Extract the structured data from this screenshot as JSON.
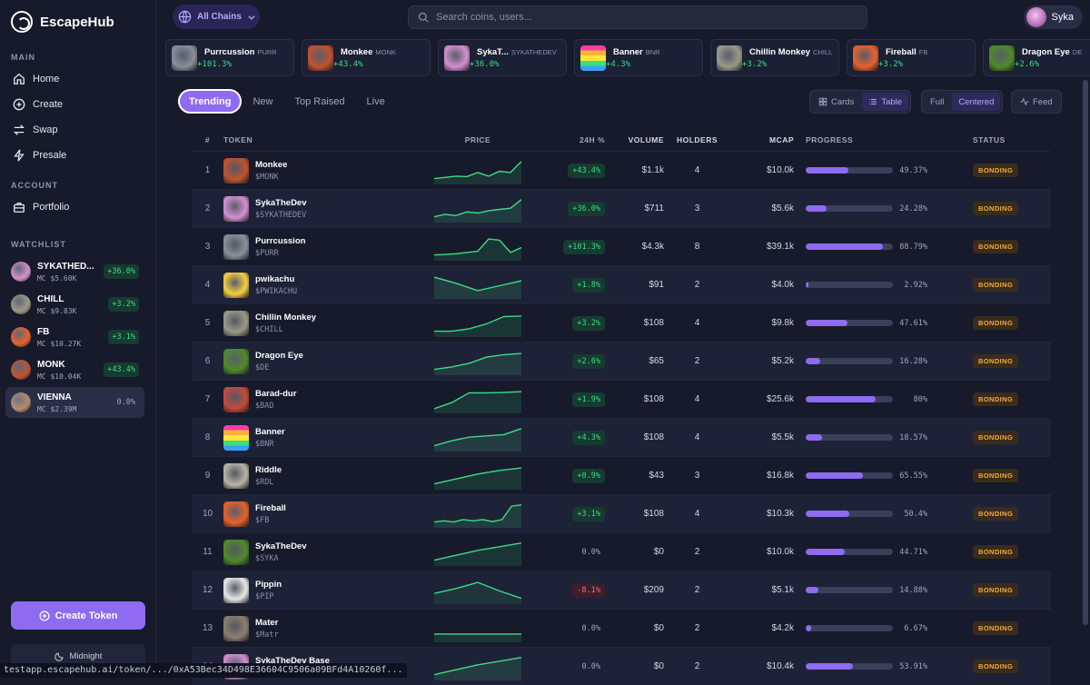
{
  "app": {
    "name": "EscapeHub"
  },
  "sidebar": {
    "main_label": "MAIN",
    "nav": [
      {
        "label": "Home",
        "icon": "home-icon"
      },
      {
        "label": "Create",
        "icon": "plus-circle-icon"
      },
      {
        "label": "Swap",
        "icon": "swap-icon"
      },
      {
        "label": "Presale",
        "icon": "bolt-icon"
      }
    ],
    "account_label": "ACCOUNT",
    "account_nav": [
      {
        "label": "Portfolio",
        "icon": "briefcase-icon"
      }
    ],
    "watchlist_label": "WATCHLIST",
    "watchlist": [
      {
        "symbol": "SYKATHED...",
        "mc": "MC $5.60K",
        "change": "+36.0%",
        "dir": "up",
        "color": "#d48fd0"
      },
      {
        "symbol": "CHILL",
        "mc": "MC $9.83K",
        "change": "+3.2%",
        "dir": "up",
        "color": "#9a9a8a"
      },
      {
        "symbol": "FB",
        "mc": "MC $10.27K",
        "change": "+3.1%",
        "dir": "up",
        "color": "#e8612c"
      },
      {
        "symbol": "MONK",
        "mc": "MC $10.04K",
        "change": "+43.4%",
        "dir": "up",
        "color": "#c0532f"
      },
      {
        "symbol": "VIENNA",
        "mc": "MC $2.39M",
        "change": "0.0%",
        "dir": "flat",
        "color": "#b58b6b"
      }
    ],
    "create_button": "Create Token",
    "theme_button": "Midnight"
  },
  "topbar": {
    "chains_label": "All Chains",
    "search_placeholder": "Search coins, users...",
    "user_name": "Syka"
  },
  "ticker": [
    {
      "name": "Purrcussion",
      "symbol": "PURR",
      "change": "+101.3%",
      "color": "#8a8f9a"
    },
    {
      "name": "Monkee",
      "symbol": "MONK",
      "change": "+43.4%",
      "color": "#c0532f"
    },
    {
      "name": "SykaT...",
      "symbol": "SYKATHEDEV",
      "change": "+36.0%",
      "color": "#d48fd0"
    },
    {
      "name": "Banner",
      "symbol": "BNR",
      "change": "+4.3%",
      "color": "#ff3fa0"
    },
    {
      "name": "Chillin Monkey",
      "symbol": "CHILL",
      "change": "+3.2%",
      "color": "#9a9a8a"
    },
    {
      "name": "Fireball",
      "symbol": "FB",
      "change": "+3.2%",
      "color": "#e8612c"
    },
    {
      "name": "Dragon Eye",
      "symbol": "DE",
      "change": "+2.6%",
      "color": "#4f8a2a"
    }
  ],
  "tabs": [
    "Trending",
    "New",
    "Top Raised",
    "Live"
  ],
  "view_toggle": {
    "cards": "Cards",
    "table": "Table"
  },
  "layout_toggle": {
    "full": "Full",
    "centered": "Centered"
  },
  "feed_button": "Feed",
  "table": {
    "headers": {
      "num": "#",
      "token": "TOKEN",
      "price": "PRICE",
      "change": "24H %",
      "volume": "VOLUME",
      "holders": "HOLDERS",
      "mcap": "MCAP",
      "progress": "PROGRESS",
      "status": "STATUS"
    },
    "rows": [
      {
        "num": "1",
        "name": "Monkee",
        "symbol": "$MONK",
        "change": "+43.4%",
        "dir": "up",
        "volume": "$1.1k",
        "holders": "4",
        "mcap": "$10.0k",
        "progress": 49.37,
        "progress_label": "49.37%",
        "status": "BONDING",
        "color": "#c0532f",
        "spark": [
          0.2,
          0.25,
          0.3,
          0.28,
          0.45,
          0.3,
          0.5,
          0.45,
          0.9
        ]
      },
      {
        "num": "2",
        "name": "SykaTheDev",
        "symbol": "$SYKATHEDEV",
        "change": "+36.0%",
        "dir": "up",
        "volume": "$711",
        "holders": "3",
        "mcap": "$5.6k",
        "progress": 24.28,
        "progress_label": "24.28%",
        "status": "BONDING",
        "color": "#d48fd0",
        "spark": [
          0.2,
          0.3,
          0.25,
          0.4,
          0.35,
          0.45,
          0.5,
          0.55,
          0.9
        ]
      },
      {
        "num": "3",
        "name": "Purrcussion",
        "symbol": "$PURR",
        "change": "+101.3%",
        "dir": "up",
        "volume": "$4.3k",
        "holders": "8",
        "mcap": "$39.1k",
        "progress": 88.79,
        "progress_label": "88.79%",
        "status": "BONDING",
        "color": "#8a8f9a",
        "spark": [
          0.2,
          0.22,
          0.25,
          0.3,
          0.35,
          0.85,
          0.8,
          0.3,
          0.5
        ]
      },
      {
        "num": "4",
        "name": "pwikachu",
        "symbol": "$PWIKACHU",
        "change": "+1.8%",
        "dir": "up",
        "volume": "$91",
        "holders": "2",
        "mcap": "$4.0k",
        "progress": 2.92,
        "progress_label": "2.92%",
        "status": "BONDING",
        "color": "#f4d03f",
        "spark": [
          0.85,
          0.6,
          0.3,
          0.5,
          0.7
        ]
      },
      {
        "num": "5",
        "name": "Chillin Monkey",
        "symbol": "$CHILL",
        "change": "+3.2%",
        "dir": "up",
        "volume": "$108",
        "holders": "4",
        "mcap": "$9.8k",
        "progress": 47.61,
        "progress_label": "47.61%",
        "status": "BONDING",
        "color": "#9a9a8a",
        "spark": [
          0.2,
          0.2,
          0.3,
          0.5,
          0.8,
          0.82
        ]
      },
      {
        "num": "6",
        "name": "Dragon Eye",
        "symbol": "$DE",
        "change": "+2.6%",
        "dir": "up",
        "volume": "$65",
        "holders": "2",
        "mcap": "$5.2k",
        "progress": 16.28,
        "progress_label": "16.28%",
        "status": "BONDING",
        "color": "#4f8a2a",
        "spark": [
          0.2,
          0.3,
          0.45,
          0.7,
          0.8,
          0.85
        ]
      },
      {
        "num": "7",
        "name": "Barad-dur",
        "symbol": "$BAD",
        "change": "+1.9%",
        "dir": "up",
        "volume": "$108",
        "holders": "4",
        "mcap": "$25.6k",
        "progress": 80,
        "progress_label": "80%",
        "status": "BONDING",
        "color": "#c44a3a",
        "spark": [
          0.15,
          0.4,
          0.8,
          0.8,
          0.82,
          0.85
        ]
      },
      {
        "num": "8",
        "name": "Banner",
        "symbol": "$BNR",
        "change": "+4.3%",
        "dir": "up",
        "volume": "$108",
        "holders": "4",
        "mcap": "$5.5k",
        "progress": 18.57,
        "progress_label": "18.57%",
        "status": "BONDING",
        "color": "#ff3fa0",
        "spark": [
          0.2,
          0.4,
          0.55,
          0.6,
          0.65,
          0.9
        ]
      },
      {
        "num": "9",
        "name": "Riddle",
        "symbol": "$RDL",
        "change": "+0.9%",
        "dir": "up",
        "volume": "$43",
        "holders": "3",
        "mcap": "$16.8k",
        "progress": 65.55,
        "progress_label": "65.55%",
        "status": "BONDING",
        "color": "#b8b4a8",
        "spark": [
          0.2,
          0.4,
          0.6,
          0.75,
          0.85
        ]
      },
      {
        "num": "10",
        "name": "Fireball",
        "symbol": "$FB",
        "change": "+3.1%",
        "dir": "up",
        "volume": "$108",
        "holders": "4",
        "mcap": "$10.3k",
        "progress": 50.4,
        "progress_label": "50.4%",
        "status": "BONDING",
        "color": "#e8612c",
        "spark": [
          0.2,
          0.25,
          0.2,
          0.3,
          0.25,
          0.3,
          0.22,
          0.3,
          0.85,
          0.9
        ]
      },
      {
        "num": "11",
        "name": "SykaTheDev",
        "symbol": "$SYKA",
        "change": "0.0%",
        "dir": "flat",
        "volume": "$0",
        "holders": "2",
        "mcap": "$10.0k",
        "progress": 44.71,
        "progress_label": "44.71%",
        "status": "BONDING",
        "color": "#4f8a2a",
        "spark": [
          0.2,
          0.4,
          0.6,
          0.75,
          0.9
        ]
      },
      {
        "num": "12",
        "name": "Pippin",
        "symbol": "$PIP",
        "change": "-8.1%",
        "dir": "down",
        "volume": "$209",
        "holders": "2",
        "mcap": "$5.1k",
        "progress": 14.88,
        "progress_label": "14.88%",
        "status": "BONDING",
        "color": "#e8e8e8",
        "spark": [
          0.4,
          0.6,
          0.85,
          0.5,
          0.2
        ]
      },
      {
        "num": "13",
        "name": "Mater",
        "symbol": "$Matr",
        "change": "0.0%",
        "dir": "flat",
        "volume": "$0",
        "holders": "2",
        "mcap": "$4.2k",
        "progress": 6.67,
        "progress_label": "6.67%",
        "status": "BONDING",
        "color": "#8a8070",
        "spark": [
          0.3,
          0.3,
          0.3,
          0.3
        ]
      },
      {
        "num": "14",
        "name": "SykaTheDev Base",
        "symbol": "$SYKA",
        "change": "0.0%",
        "dir": "flat",
        "volume": "$0",
        "holders": "2",
        "mcap": "$10.4k",
        "progress": 53.91,
        "progress_label": "53.91%",
        "status": "BONDING",
        "color": "#d48fd0",
        "spark": [
          0.2,
          0.4,
          0.6,
          0.75,
          0.9
        ]
      }
    ]
  },
  "status_bar": "testapp.escapehub.ai/token/.../0xA53Bec34D498E36604C9506a09BFd4A10260f...",
  "colors": {
    "accent": "#8e6bf0",
    "up": "#3ddc84",
    "down": "#ff6b7a",
    "bonding": "#f2a93b"
  }
}
